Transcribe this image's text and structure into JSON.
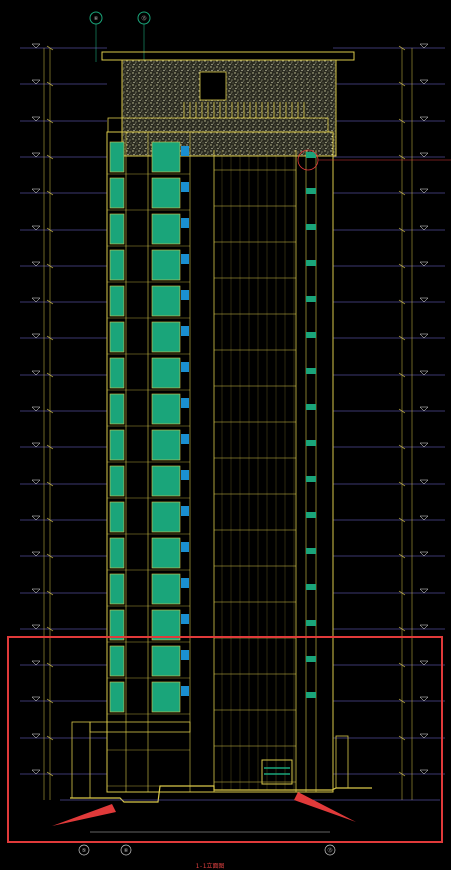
{
  "drawing": {
    "axis_labels": [
      "⑥",
      "⑬"
    ],
    "bottom_axis_labels": [
      "⑤",
      "⑥",
      "⑬"
    ],
    "title_text": "1-1立面图",
    "highlight_color": "#e03a3a",
    "window_color": "#1aa57a",
    "line_color": "#d9c84a",
    "grid_color": "#7b6fe0"
  }
}
